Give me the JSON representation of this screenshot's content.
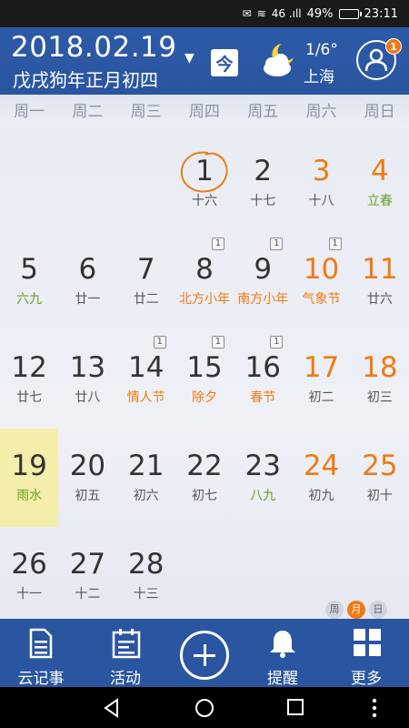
{
  "status_bar": {
    "signal_text": "46 .ıll",
    "battery": "49%",
    "battery_level": 0.49,
    "time": "23:11"
  },
  "header": {
    "date": "2018.02.19",
    "lunar": "戊戌狗年正月初四",
    "today_label": "今",
    "weather_icon": "moon-cloud-icon",
    "temperature": "1/6°",
    "city": "上海",
    "notification_count": "1"
  },
  "weekdays": [
    "周一",
    "周二",
    "周三",
    "周四",
    "周五",
    "周六",
    "周日"
  ],
  "calendar": {
    "selected_day": "19",
    "today_day": "1",
    "weeks": [
      [
        {
          "day": "",
          "sub": ""
        },
        {
          "day": "",
          "sub": ""
        },
        {
          "day": "",
          "sub": ""
        },
        {
          "day": "1",
          "sub": "十六",
          "today": true
        },
        {
          "day": "2",
          "sub": "十七"
        },
        {
          "day": "3",
          "sub": "十八",
          "weekend": true
        },
        {
          "day": "4",
          "sub": "立春",
          "weekend": true,
          "term": true
        }
      ],
      [
        {
          "day": "5",
          "sub": "六九",
          "term": true
        },
        {
          "day": "6",
          "sub": "廿一"
        },
        {
          "day": "7",
          "sub": "廿二"
        },
        {
          "day": "8",
          "sub": "北方小年",
          "fest": true,
          "badge": "1"
        },
        {
          "day": "9",
          "sub": "南方小年",
          "fest": true,
          "badge": "1"
        },
        {
          "day": "10",
          "sub": "气象节",
          "weekend": true,
          "fest": true,
          "badge": "1"
        },
        {
          "day": "11",
          "sub": "廿六",
          "weekend": true
        }
      ],
      [
        {
          "day": "12",
          "sub": "廿七"
        },
        {
          "day": "13",
          "sub": "廿八"
        },
        {
          "day": "14",
          "sub": "情人节",
          "fest": true,
          "badge": "1"
        },
        {
          "day": "15",
          "sub": "除夕",
          "fest": true,
          "badge": "1"
        },
        {
          "day": "16",
          "sub": "春节",
          "fest": true,
          "badge": "1"
        },
        {
          "day": "17",
          "sub": "初二",
          "weekend": true
        },
        {
          "day": "18",
          "sub": "初三",
          "weekend": true
        }
      ],
      [
        {
          "day": "19",
          "sub": "雨水",
          "term": true,
          "selected": true
        },
        {
          "day": "20",
          "sub": "初五"
        },
        {
          "day": "21",
          "sub": "初六"
        },
        {
          "day": "22",
          "sub": "初七"
        },
        {
          "day": "23",
          "sub": "八九",
          "term": true
        },
        {
          "day": "24",
          "sub": "初九",
          "weekend": true
        },
        {
          "day": "25",
          "sub": "初十",
          "weekend": true
        }
      ],
      [
        {
          "day": "26",
          "sub": "十一"
        },
        {
          "day": "27",
          "sub": "十二"
        },
        {
          "day": "28",
          "sub": "十三"
        },
        {
          "day": "",
          "sub": ""
        },
        {
          "day": "",
          "sub": ""
        },
        {
          "day": "",
          "sub": ""
        },
        {
          "day": "",
          "sub": ""
        }
      ]
    ]
  },
  "view_switch": {
    "week": "周",
    "month": "月",
    "day": "日",
    "active": "month"
  },
  "bottom_nav": {
    "notes": "云记事",
    "activity": "活动",
    "add_icon": "plus-circle-icon",
    "reminder": "提醒",
    "more": "更多"
  },
  "colors": {
    "primary": "#2a55a0",
    "accent": "#f07a12",
    "solar_term": "#6a9e1f",
    "selected_bg": "#f3eeaa"
  }
}
